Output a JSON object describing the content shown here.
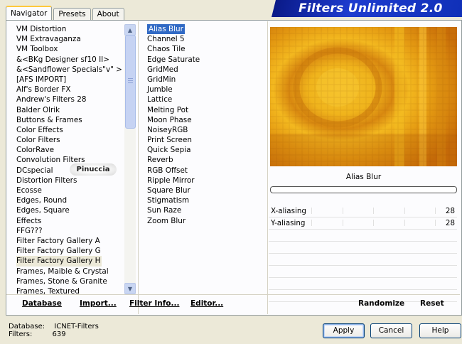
{
  "tabs": [
    "Navigator",
    "Presets",
    "About"
  ],
  "app_title": "Filters Unlimited 2.0",
  "categories": [
    "VM Distortion",
    "VM Extravaganza",
    "VM Toolbox",
    "&<BKg Designer sf10 II>",
    "&<Sandflower Specials\"v\" >",
    "[AFS IMPORT]",
    "Alf's Border FX",
    "Andrew's Filters 28",
    "Balder Olrik",
    "Buttons & Frames",
    "Color Effects",
    "Color Filters",
    "ColorRave",
    "Convolution Filters",
    "DCspecial",
    "Distortion Filters",
    "Ecosse",
    "Edges, Round",
    "Edges, Square",
    "Effects",
    "FFG???",
    "Filter Factory Gallery A",
    "Filter Factory Gallery G",
    "Filter Factory Gallery H",
    "Frames, Maible & Crystal",
    "Frames, Stone & Granite",
    "Frames, Textured"
  ],
  "selected_category": "Filter Factory Gallery H",
  "watermark": "Pinuccia",
  "filters": [
    "Alias Blur",
    "Channel 5",
    "Chaos Tile",
    "Edge Saturate",
    "GridMed",
    "GridMin",
    "Jumble",
    "Lattice",
    "Melting Pot",
    "Moon Phase",
    "NoiseyRGB",
    "Print Screen",
    "Quick Sepia",
    "Reverb",
    "RGB Offset",
    "Ripple Mirror",
    "Square Blur",
    "Stigmatism",
    "Sun Raze",
    "Zoom Blur"
  ],
  "selected_filter": "Alias Blur",
  "preview_filter_name": "Alias Blur",
  "params": [
    {
      "name": "X-aliasing",
      "value": "28"
    },
    {
      "name": "Y-aliasing",
      "value": "28"
    }
  ],
  "bottom_buttons": {
    "database": "Database",
    "import": "Import...",
    "filter_info": "Filter Info...",
    "editor": "Editor...",
    "randomize": "Randomize",
    "reset": "Reset"
  },
  "status": {
    "database_label": "Database:",
    "database_value": "ICNET-Filters",
    "filters_label": "Filters:",
    "filters_value": "639"
  },
  "dialog_buttons": {
    "apply": "Apply",
    "cancel": "Cancel",
    "help": "Help"
  },
  "colors": {
    "banner": "#1e3ccf",
    "selection": "#316ac5",
    "preview_base": "#e8a418"
  }
}
